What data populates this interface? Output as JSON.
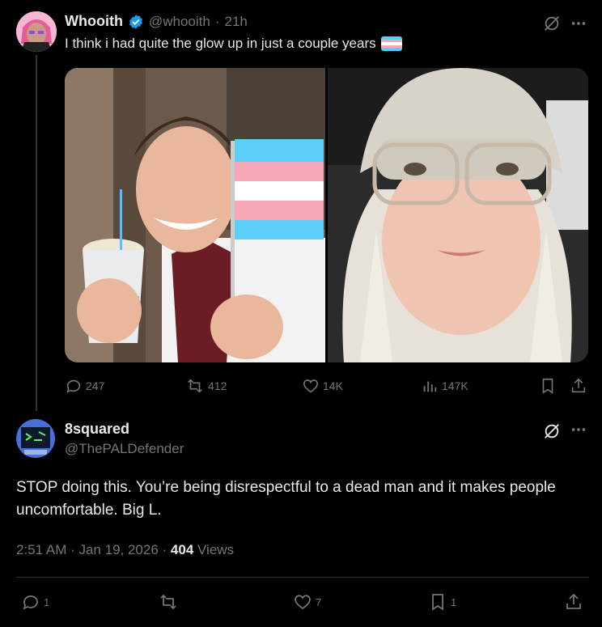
{
  "colors": {
    "accent": "#1d9bf0",
    "muted": "#71767b",
    "text": "#e7e9ea",
    "border": "#2f3336"
  },
  "parent": {
    "display_name": "Whooith",
    "handle": "@whooith",
    "time": "21h",
    "text": "I think i had quite the glow up in just a couple years",
    "stats": {
      "replies": "247",
      "reposts": "412",
      "likes": "14K",
      "views": "147K"
    }
  },
  "reply": {
    "display_name": "8squared",
    "handle": "@ThePALDefender",
    "text": "STOP doing this. You’re being disrespectful to a dead man and it makes people uncomfortable. Big L.",
    "timestamp": "2:51 AM · Jan 19, 2026 · ",
    "views_count": "404",
    "views_label": " Views",
    "stats": {
      "replies": "1",
      "reposts": "",
      "likes": "7",
      "bookmarks": "1"
    }
  }
}
